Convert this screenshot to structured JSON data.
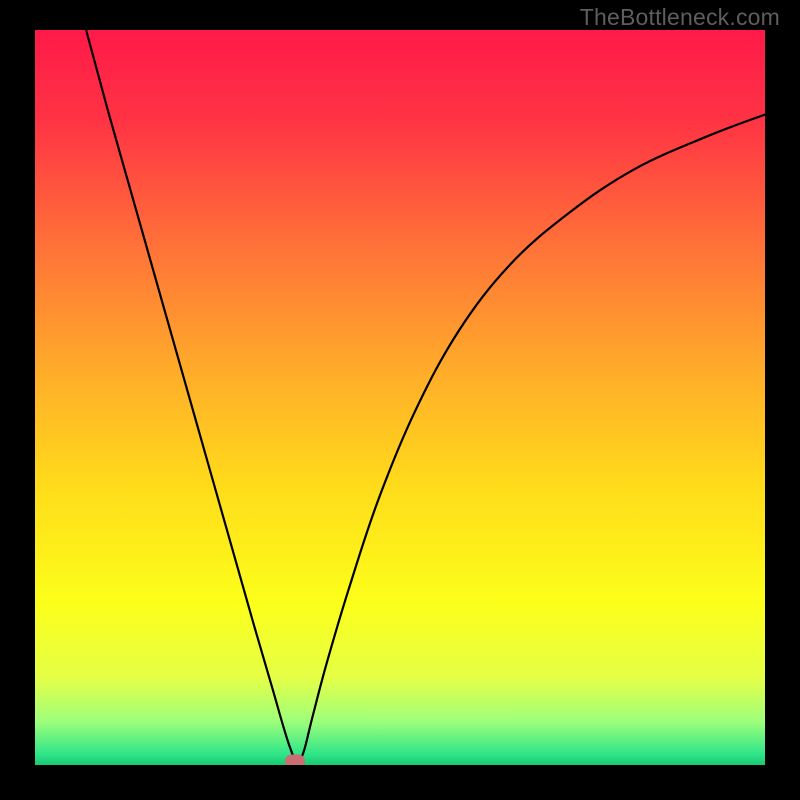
{
  "watermark": "TheBottleneck.com",
  "chart_data": {
    "type": "line",
    "title": "",
    "xlabel": "",
    "ylabel": "",
    "xlim": [
      0,
      100
    ],
    "ylim": [
      0,
      100
    ],
    "background_gradient": {
      "stops": [
        {
          "pos": 0.0,
          "color": "#ff1a49"
        },
        {
          "pos": 0.12,
          "color": "#ff3244"
        },
        {
          "pos": 0.3,
          "color": "#ff7438"
        },
        {
          "pos": 0.48,
          "color": "#ffb128"
        },
        {
          "pos": 0.62,
          "color": "#ffdb1a"
        },
        {
          "pos": 0.78,
          "color": "#fcff1a"
        },
        {
          "pos": 0.88,
          "color": "#e5ff46"
        },
        {
          "pos": 0.94,
          "color": "#9fff7a"
        },
        {
          "pos": 0.985,
          "color": "#30e588"
        },
        {
          "pos": 1.0,
          "color": "#19c873"
        }
      ]
    },
    "series": [
      {
        "name": "bottleneck-curve",
        "x": [
          7.0,
          10,
          14,
          18,
          22,
          26,
          30,
          32.5,
          34,
          35,
          35.9,
          36.8,
          38,
          40,
          43,
          47,
          52,
          58,
          65,
          73,
          82,
          92,
          100
        ],
        "y": [
          100,
          89,
          75,
          61,
          47,
          33,
          19,
          10.5,
          5.3,
          2.2,
          0.4,
          1.8,
          6.5,
          14,
          24,
          36,
          48,
          59,
          68,
          75,
          81,
          85.5,
          88.5
        ]
      }
    ],
    "marker": {
      "x": 35.6,
      "y": 0.0,
      "color": "#cb6e73"
    }
  }
}
